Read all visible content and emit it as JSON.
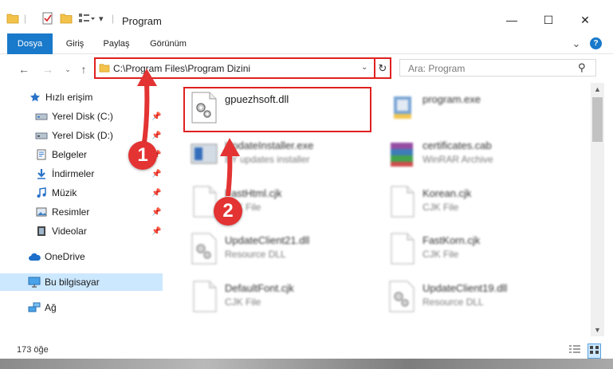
{
  "window": {
    "title": "Program",
    "controls": {
      "minimize": "—",
      "maximize": "☐",
      "close": "✕"
    }
  },
  "ribbon": {
    "tabs": [
      "Dosya",
      "Giriş",
      "Paylaş",
      "Görünüm"
    ],
    "collapse_icon": "⌄",
    "help_icon": "?"
  },
  "address": {
    "path": "C:\\Program Files\\Program Dizini",
    "search_placeholder": "Ara: Program"
  },
  "navigation": {
    "items": [
      {
        "label": "Hızlı erişim",
        "icon": "star-icon",
        "pinned": false
      },
      {
        "label": "Yerel Disk (C:)",
        "icon": "drive-icon",
        "pinned": true
      },
      {
        "label": "Yerel Disk (D:)",
        "icon": "drive-icon",
        "pinned": true
      },
      {
        "label": "Belgeler",
        "icon": "documents-icon",
        "pinned": true
      },
      {
        "label": "İndirmeler",
        "icon": "download-icon",
        "pinned": true
      },
      {
        "label": "Müzik",
        "icon": "music-icon",
        "pinned": true
      },
      {
        "label": "Resimler",
        "icon": "pictures-icon",
        "pinned": true
      },
      {
        "label": "Videolar",
        "icon": "videos-icon",
        "pinned": true
      },
      {
        "label": "OneDrive",
        "icon": "cloud-icon",
        "pinned": false
      },
      {
        "label": "Bu bilgisayar",
        "icon": "computer-icon",
        "pinned": false
      },
      {
        "label": "Ağ",
        "icon": "network-icon",
        "pinned": false
      }
    ]
  },
  "files": [
    {
      "name": "gpuezhsoft.dll",
      "type": "",
      "icon": "dll-gear-icon"
    },
    {
      "name": "program.exe",
      "type": "",
      "icon": "exe-icon"
    },
    {
      "name": "UpdateInstaller.exe",
      "type": "BY updates installer",
      "icon": "installer-icon"
    },
    {
      "name": "certificates.cab",
      "type": "WinRAR Archive",
      "icon": "archive-icon"
    },
    {
      "name": "FastHtml.cjk",
      "type": "CJK File",
      "icon": "blank-file-icon"
    },
    {
      "name": "Korean.cjk",
      "type": "CJK File",
      "icon": "blank-file-icon"
    },
    {
      "name": "UpdateClient21.dll",
      "type": "Resource DLL",
      "icon": "dll-gear-icon"
    },
    {
      "name": "FastKorn.cjk",
      "type": "CJK File",
      "icon": "blank-file-icon"
    },
    {
      "name": "DefaultFont.cjk",
      "type": "CJK File",
      "icon": "blank-file-icon"
    },
    {
      "name": "UpdateClient19.dll",
      "type": "Resource DLL",
      "icon": "dll-gear-icon"
    }
  ],
  "status": {
    "count": "173 öğe"
  },
  "annotations": {
    "marker1": "1",
    "marker2": "2"
  },
  "colors": {
    "accent": "#1979ca",
    "highlight": "#e02020",
    "marker": "#e33333",
    "selected": "#cce8ff"
  }
}
